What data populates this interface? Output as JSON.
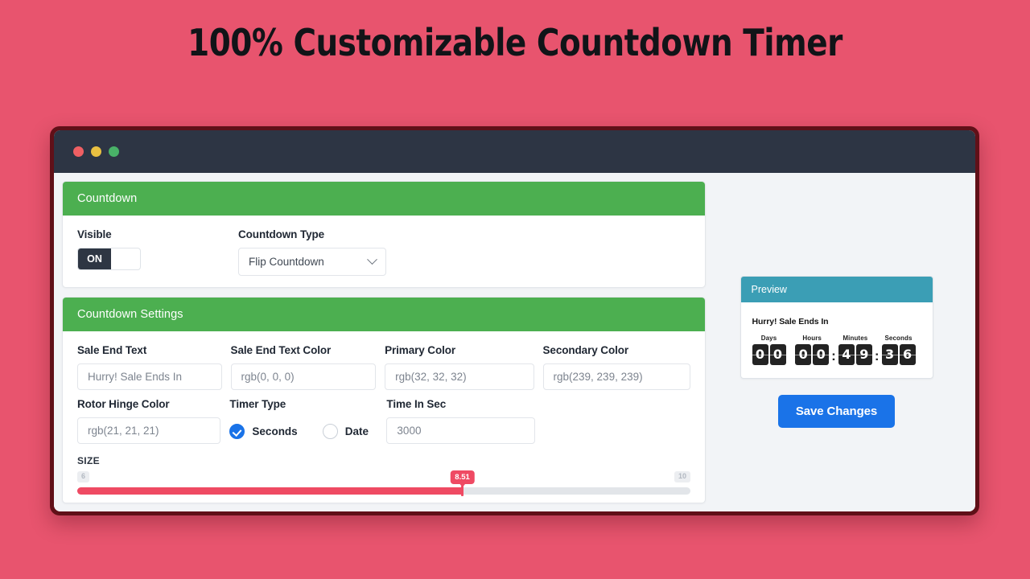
{
  "headline": "100% Customizable Countdown Timer",
  "colors": {
    "page_background": "#e8546e",
    "frame_border": "#601018",
    "titlebar": "#2d3544",
    "panel_header_green": "#4CAF50",
    "preview_header_teal": "#3b9eb5",
    "accent_blue": "#1a73e8",
    "slider_red": "#ef4a63",
    "dot_red": "#ef5f63",
    "dot_yellow": "#e9c041",
    "dot_green": "#49b268"
  },
  "window": {
    "dots": [
      "close-dot",
      "minimize-dot",
      "maximize-dot"
    ]
  },
  "countdown_panel": {
    "header": "Countdown",
    "visible": {
      "label": "Visible",
      "toggle_state": "ON"
    },
    "countdown_type": {
      "label": "Countdown Type",
      "value": "Flip Countdown",
      "options": [
        "Flip Countdown"
      ]
    }
  },
  "settings_panel": {
    "header": "Countdown Settings",
    "fields": [
      {
        "label": "Sale End Text",
        "value": "Hurry! Sale Ends In"
      },
      {
        "label": "Sale End Text Color",
        "value": "rgb(0, 0, 0)"
      },
      {
        "label": "Primary Color",
        "value": "rgb(32, 32, 32)"
      },
      {
        "label": "Secondary Color",
        "value": "rgb(239, 239, 239)"
      },
      {
        "label": "Rotor Hinge Color",
        "value": "rgb(21, 21, 21)"
      },
      {
        "label": "Time In Sec",
        "value": "3000"
      }
    ],
    "timer_type": {
      "label": "Timer Type",
      "options": [
        {
          "label": "Seconds",
          "selected": true
        },
        {
          "label": "Date",
          "selected": false
        }
      ]
    },
    "size_slider": {
      "label": "SIZE",
      "min": "6",
      "max": "10",
      "value": "8.51",
      "fill_percent": 62.8
    }
  },
  "preview": {
    "header": "Preview",
    "sale_text": "Hurry! Sale Ends In",
    "units": [
      {
        "caption": "Days",
        "d1": "0",
        "d2": "0"
      },
      {
        "caption": "Hours",
        "d1": "0",
        "d2": "0"
      },
      {
        "caption": "Minutes",
        "d1": "4",
        "d2": "9"
      },
      {
        "caption": "Seconds",
        "d1": "3",
        "d2": "6"
      }
    ],
    "separator": ":",
    "save_label": "Save Changes"
  }
}
